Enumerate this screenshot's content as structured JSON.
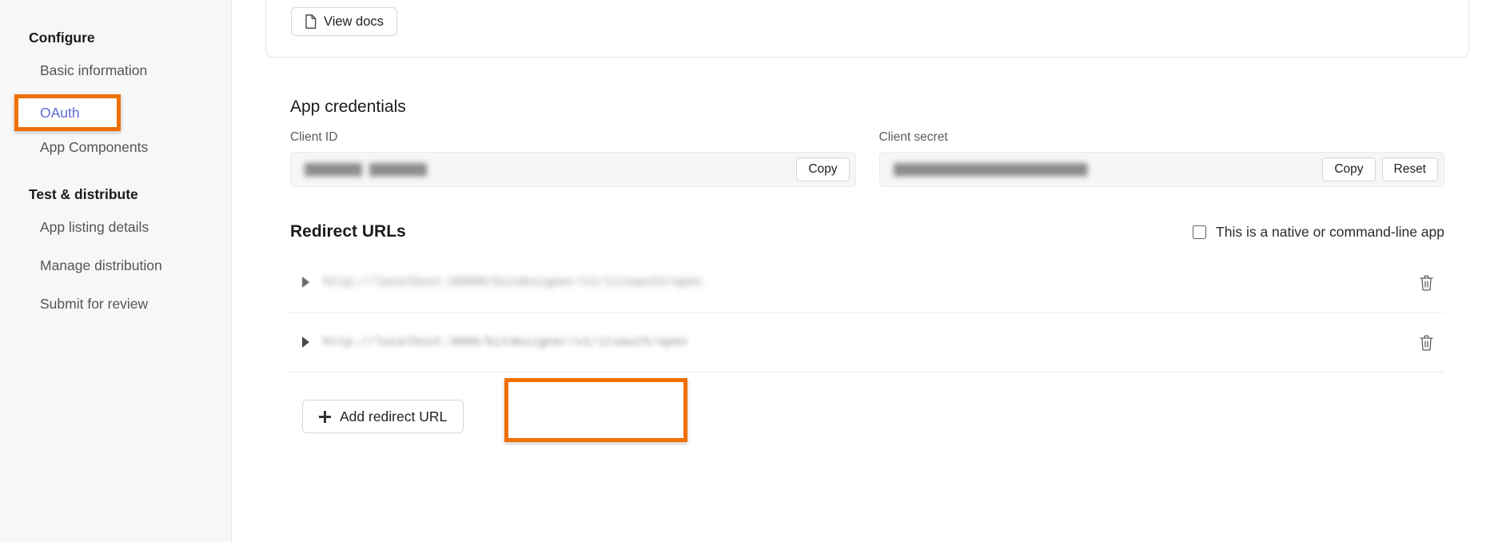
{
  "sidebar": {
    "groups": [
      {
        "title": "Configure",
        "items": [
          {
            "label": "Basic information",
            "active": false
          },
          {
            "label": "OAuth",
            "active": true
          },
          {
            "label": "App Components",
            "active": false
          }
        ]
      },
      {
        "title": "Test & distribute",
        "items": [
          {
            "label": "App listing details",
            "active": false
          },
          {
            "label": "Manage distribution",
            "active": false
          },
          {
            "label": "Submit for review",
            "active": false
          }
        ]
      }
    ]
  },
  "top_card": {
    "view_docs_label": "View docs",
    "doc_icon": "document-icon"
  },
  "credentials": {
    "title": "App credentials",
    "client_id": {
      "label": "Client ID",
      "value": "████████ ████████",
      "copy_label": "Copy"
    },
    "client_secret": {
      "label": "Client secret",
      "value": "███████████████████████████",
      "copy_label": "Copy",
      "reset_label": "Reset"
    }
  },
  "redirect_urls": {
    "title": "Redirect URLs",
    "native_checkbox": {
      "label": "This is a native or command-line app",
      "checked": false
    },
    "rows": [
      {
        "url": "http://localhost:58000/bitdesigner/v1/itcoauth/open",
        "caret_icon": "chevron-right-icon",
        "delete_icon": "trash-icon"
      },
      {
        "url": "http://localhost:3000/bitdesigner/v1/itoauth/open",
        "caret_icon": "chevron-right-icon",
        "delete_icon": "trash-icon"
      }
    ],
    "add_button": {
      "label": "Add redirect URL",
      "icon": "plus-icon"
    }
  },
  "annotations": {
    "highlight_color": "#f07000",
    "targets": [
      "OAuth",
      "Add redirect URL"
    ]
  }
}
